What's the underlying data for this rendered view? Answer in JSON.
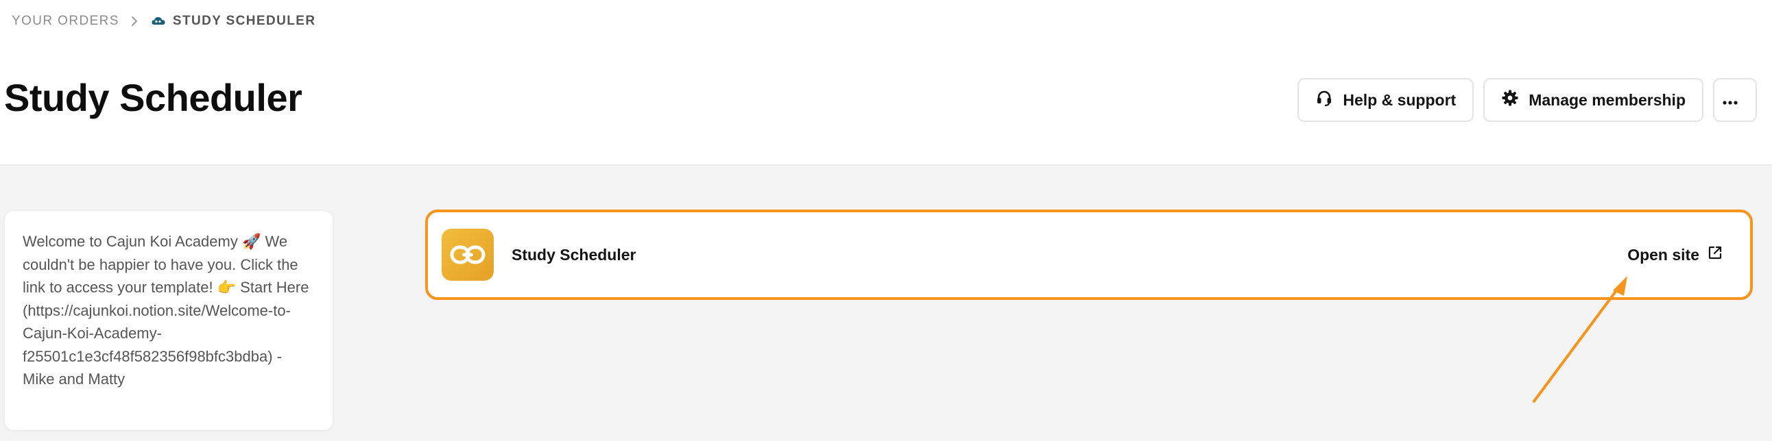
{
  "breadcrumb": {
    "parent": "YOUR ORDERS",
    "current": "STUDY SCHEDULER"
  },
  "page": {
    "title": "Study Scheduler"
  },
  "actions": {
    "help_label": "Help & support",
    "manage_label": "Manage membership",
    "more_icon": "ellipsis-icon"
  },
  "welcome": {
    "message": "Welcome to Cajun Koi Academy 🚀 We couldn't be happier to have you. Click the link to access your template! 👉 Start Here (https://cajunkoi.notion.site/Welcome-to-Cajun-Koi-Academy-f25501c1e3cf48f582356f98bfc3bdba) - Mike and Matty"
  },
  "product": {
    "name": "Study Scheduler",
    "open_label": "Open site",
    "icon": "link-icon"
  },
  "colors": {
    "highlight": "#f7941d",
    "product_icon": "#e9ab2d",
    "background": "#f4f4f4"
  }
}
